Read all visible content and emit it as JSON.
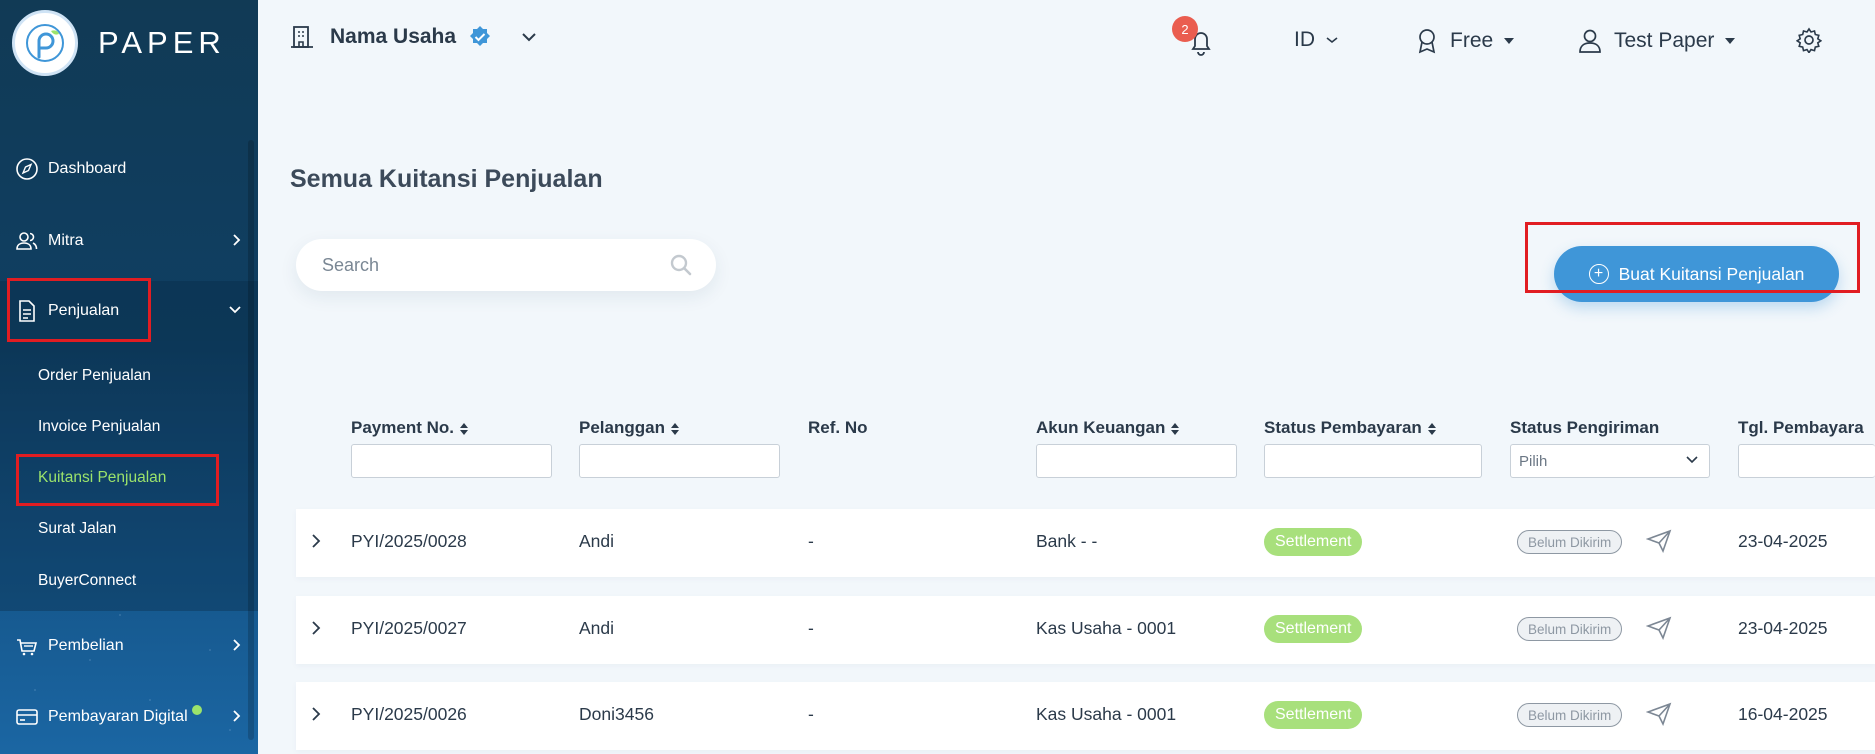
{
  "brand": {
    "name": "PAPER"
  },
  "sidebar": {
    "items": [
      {
        "label": "Dashboard"
      },
      {
        "label": "Mitra"
      },
      {
        "label": "Penjualan"
      },
      {
        "label": "Pembelian"
      },
      {
        "label": "Pembayaran Digital"
      }
    ],
    "penjualan_sub": [
      {
        "label": "Order Penjualan"
      },
      {
        "label": "Invoice Penjualan"
      },
      {
        "label": "Kuitansi Penjualan"
      },
      {
        "label": "Surat Jalan"
      },
      {
        "label": "BuyerConnect"
      }
    ]
  },
  "topbar": {
    "business_name": "Nama Usaha",
    "notification_count": "2",
    "language": "ID",
    "plan": "Free",
    "user": "Test Paper"
  },
  "main": {
    "title": "Semua Kuitansi Penjualan",
    "search_placeholder": "Search",
    "create_button": "Buat Kuitansi Penjualan"
  },
  "table": {
    "headers": [
      "Payment No.",
      "Pelanggan",
      "Ref. No",
      "Akun Keuangan",
      "Status Pembayaran",
      "Status Pengiriman",
      "Tgl. Pembayara"
    ],
    "select_placeholder": "Pilih",
    "rows": [
      {
        "payment_no": "PYI/2025/0028",
        "pelanggan": "Andi",
        "ref_no": "-",
        "akun": "Bank - -",
        "status_bayar": "Settlement",
        "status_kirim": "Belum Dikirim",
        "tanggal": "23-04-2025"
      },
      {
        "payment_no": "PYI/2025/0027",
        "pelanggan": "Andi",
        "ref_no": "-",
        "akun": "Kas Usaha - 0001",
        "status_bayar": "Settlement",
        "status_kirim": "Belum Dikirim",
        "tanggal": "23-04-2025"
      },
      {
        "payment_no": "PYI/2025/0026",
        "pelanggan": "Doni3456",
        "ref_no": "-",
        "akun": "Kas Usaha - 0001",
        "status_bayar": "Settlement",
        "status_kirim": "Belum Dikirim",
        "tanggal": "16-04-2025"
      }
    ]
  },
  "colors": {
    "primary": "#3f96d8",
    "settlement": "#a8e07c",
    "highlight": "#e11d22",
    "active_link": "#9be36b"
  }
}
